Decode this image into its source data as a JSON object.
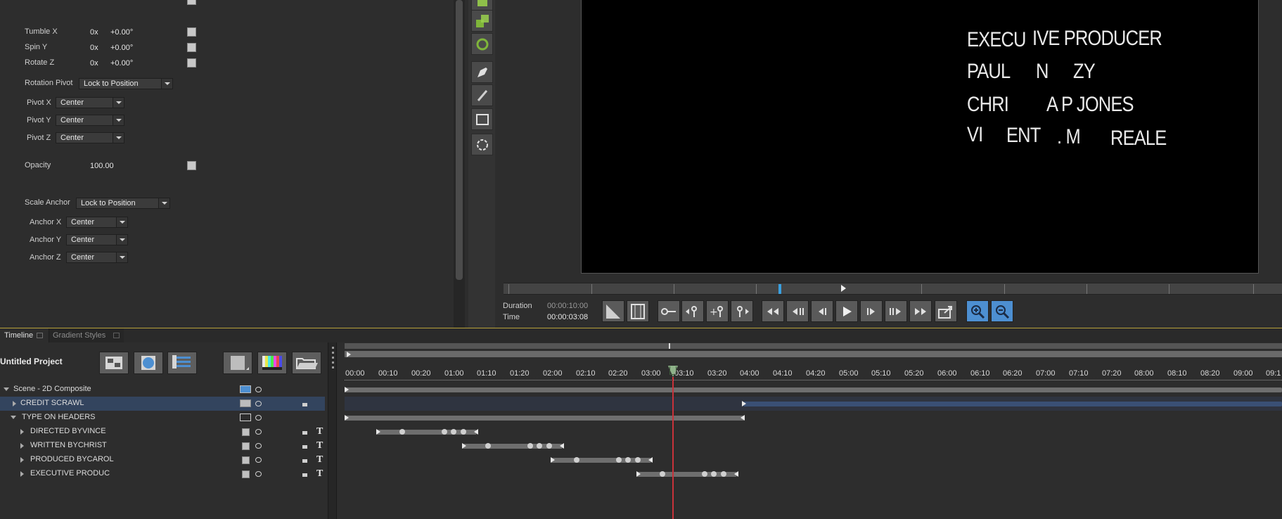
{
  "properties": {
    "rotation_rows": [
      {
        "label": "Tumble X",
        "turns": "0x",
        "degrees": "+0.00°"
      },
      {
        "label": "Spin Y",
        "turns": "0x",
        "degrees": "+0.00°"
      },
      {
        "label": "Rotate Z",
        "turns": "0x",
        "degrees": "+0.00°"
      }
    ],
    "rotation_pivot_label": "Rotation Pivot",
    "rotation_pivot_value": "Lock to Position",
    "pivot_rows": [
      {
        "label": "Pivot X",
        "value": "Center"
      },
      {
        "label": "Pivot Y",
        "value": "Center"
      },
      {
        "label": "Pivot Z",
        "value": "Center"
      }
    ],
    "opacity_label": "Opacity",
    "opacity_value": "100.00",
    "scale_anchor_label": "Scale Anchor",
    "scale_anchor_value": "Lock to Position",
    "anchor_rows": [
      {
        "label": "Anchor X",
        "value": "Center"
      },
      {
        "label": "Anchor Y",
        "value": "Center"
      },
      {
        "label": "Anchor Z",
        "value": "Center"
      }
    ]
  },
  "viewer": {
    "credit_text": [
      "EXECU",
      "IVE PRODUCER",
      "PAUL",
      "N",
      "ZY",
      "CHRI",
      "A P JONES",
      "VI",
      "ENT",
      ". M",
      "REALE"
    ],
    "duration_label": "Duration",
    "duration_value": "00:00:10:00",
    "time_label": "Time",
    "time_value": "00:00:03:08"
  },
  "tabs": {
    "timeline": "Timeline",
    "gradient_styles": "Gradient Styles"
  },
  "project_title": "Untitled Project",
  "layers": [
    {
      "name": "Scene - 2D Composite",
      "kind": "scene"
    },
    {
      "name": "CREDIT SCRAWL",
      "kind": "selected"
    },
    {
      "name": "TYPE ON HEADERS",
      "kind": "group"
    },
    {
      "name": "DIRECTED BYVINCE",
      "kind": "text"
    },
    {
      "name": "WRITTEN BYCHRIST",
      "kind": "text"
    },
    {
      "name": "PRODUCED BYCAROL",
      "kind": "text"
    },
    {
      "name": "EXECUTIVE PRODUC",
      "kind": "text"
    }
  ],
  "ruler_ticks": [
    "00:00",
    "00:10",
    "00:20",
    "01:00",
    "01:10",
    "01:20",
    "02:00",
    "02:10",
    "02:20",
    "03:00",
    "03:10",
    "03:20",
    "04:00",
    "04:10",
    "04:20",
    "05:00",
    "05:10",
    "05:20",
    "06:00",
    "06:10",
    "06:20",
    "07:00",
    "07:10",
    "07:20",
    "08:00",
    "08:10",
    "08:20",
    "09:00",
    "09:1"
  ],
  "colors": {
    "accent": "#4d8fd1",
    "selected_row": "#33445e",
    "playhead": "#c8323a",
    "panel": "#2d2d2d"
  }
}
